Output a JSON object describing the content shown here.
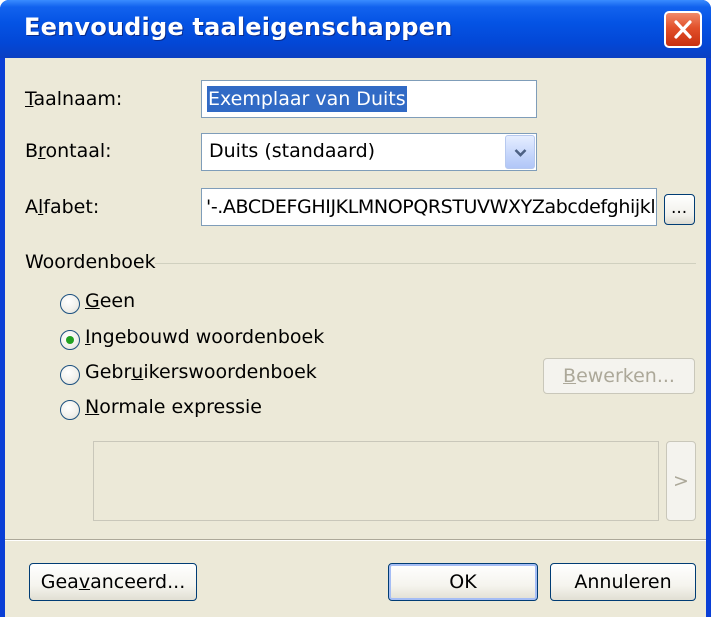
{
  "window": {
    "title": "Eenvoudige taaleigenschappen",
    "close_icon": "close-icon"
  },
  "language_name": {
    "label_mnemonic": "T",
    "label_rest": "aalnaam:",
    "value": "Exemplaar van Duits"
  },
  "source_language": {
    "label_pre": "B",
    "label_mnemonic": "r",
    "label_post": "ontaal:",
    "selected": "Duits (standaard)",
    "dropdown_icon": "chevron-down-icon"
  },
  "alphabet": {
    "label_pre": "A",
    "label_mnemonic": "l",
    "label_post": "fabet:",
    "value": "'-.ABCDEFGHIJKLMNOPQRSTUVWXYZabcdefghijklmnopqrstuvwxyz",
    "browse_label": "..."
  },
  "dictionary_group": {
    "title": "Woordenboek",
    "options": [
      {
        "mnemonic": "G",
        "rest": "een",
        "pre": "",
        "checked": false
      },
      {
        "pre": "",
        "mnemonic": "I",
        "rest": "ngebouwd woordenboek",
        "checked": true
      },
      {
        "pre": "Gebr",
        "mnemonic": "u",
        "rest": "ikerswoordenboek",
        "checked": false
      },
      {
        "pre": "",
        "mnemonic": "N",
        "rest": "ormale expressie",
        "checked": false
      }
    ],
    "edit_button_mnemonic": "B",
    "edit_button_rest": "ewerken...",
    "expression_button": ">"
  },
  "footer": {
    "advanced_pre": "Gea",
    "advanced_mnemonic": "v",
    "advanced_post": "anceerd...",
    "ok_label": "OK",
    "cancel_label": "Annuleren"
  },
  "colors": {
    "titlebar": "#0453e4",
    "dialog_background": "#ece9d8",
    "selection": "#316ac5",
    "close_button": "#e2502a",
    "radio_checked": "#21a121"
  }
}
